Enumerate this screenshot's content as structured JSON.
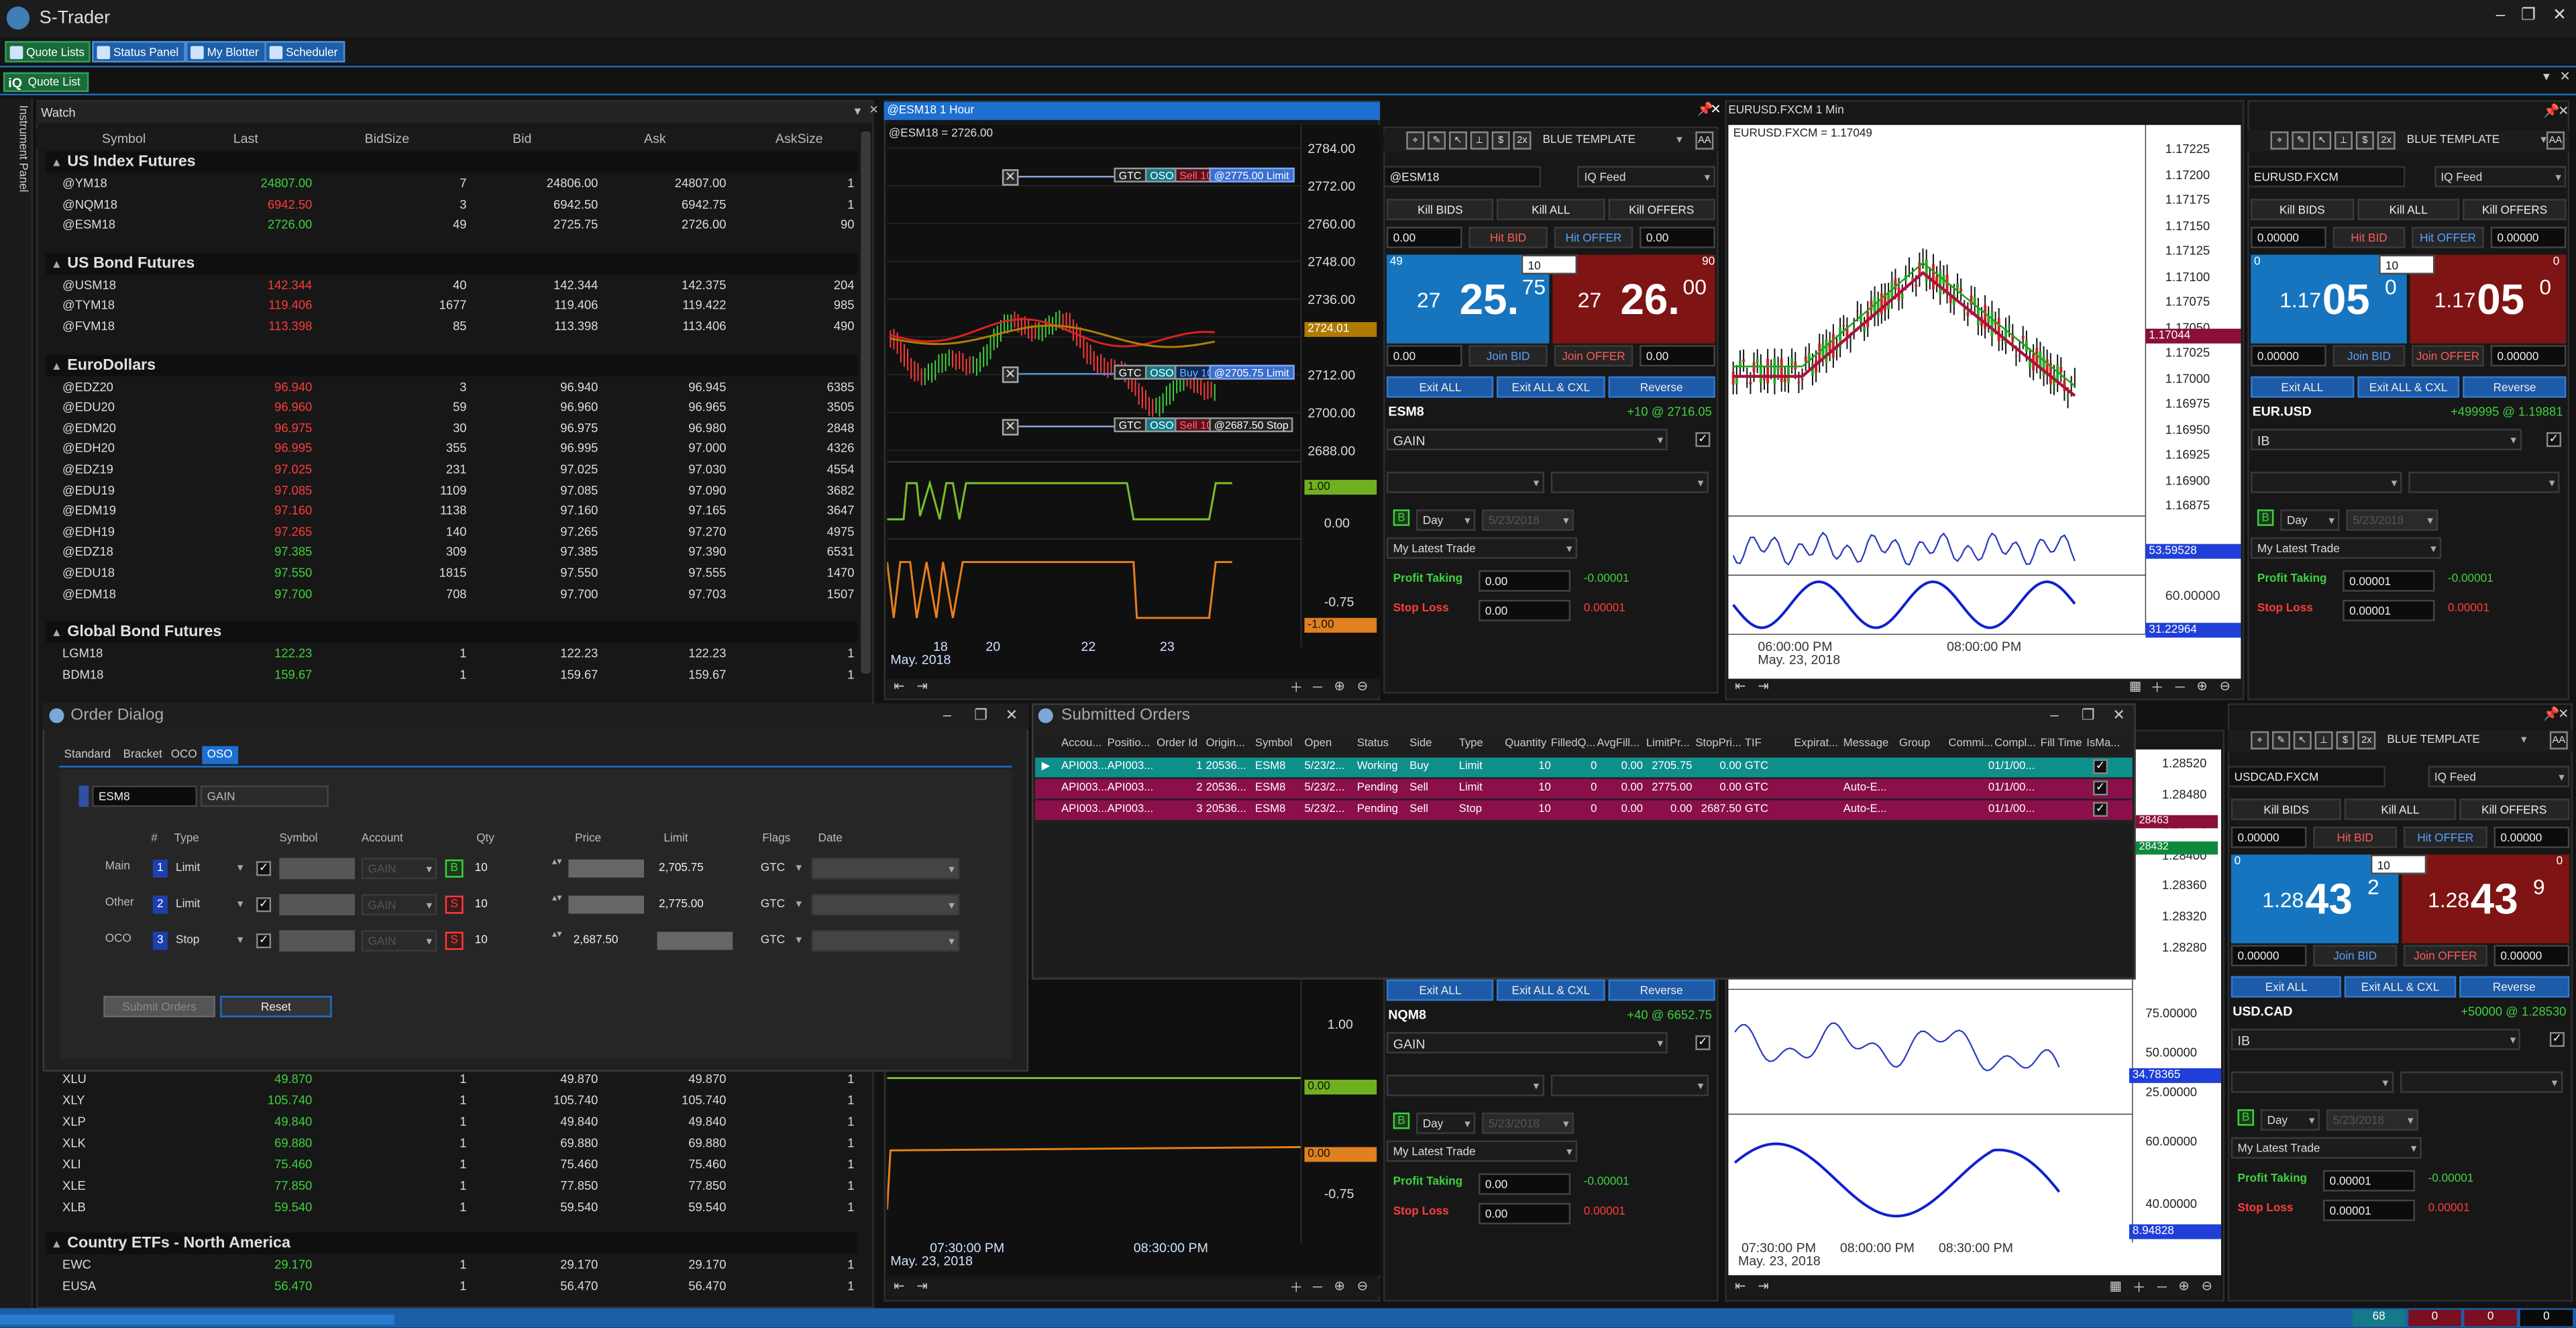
{
  "app": {
    "title": "S-Trader"
  },
  "toolbar": {
    "quote_lists": "Quote Lists",
    "status_panel": "Status Panel",
    "my_blotter": "My Blotter",
    "scheduler": "Scheduler"
  },
  "quote_list_tab": "Quote List",
  "instrument_panel": "Instrument Panel",
  "watch": {
    "title": "Watch",
    "columns": [
      "Symbol",
      "Last",
      "BidSize",
      "Bid",
      "Ask",
      "AskSize"
    ],
    "groups_top": [
      {
        "name": "US Index Futures",
        "rows": [
          {
            "symbol": "@YM18",
            "last": "24807.00",
            "dir": "up",
            "bidsize": "7",
            "bid": "24806.00",
            "ask": "24807.00",
            "asksize": "1"
          },
          {
            "symbol": "@NQM18",
            "last": "6942.50",
            "dir": "dn",
            "bidsize": "3",
            "bid": "6942.50",
            "ask": "6942.75",
            "asksize": "1"
          },
          {
            "symbol": "@ESM18",
            "last": "2726.00",
            "dir": "up",
            "bidsize": "49",
            "bid": "2725.75",
            "ask": "2726.00",
            "asksize": "90"
          }
        ]
      },
      {
        "name": "US Bond Futures",
        "rows": [
          {
            "symbol": "@USM18",
            "last": "142.344",
            "dir": "dn",
            "bidsize": "40",
            "bid": "142.344",
            "ask": "142.375",
            "asksize": "204"
          },
          {
            "symbol": "@TYM18",
            "last": "119.406",
            "dir": "dn",
            "bidsize": "1677",
            "bid": "119.406",
            "ask": "119.422",
            "asksize": "985"
          },
          {
            "symbol": "@FVM18",
            "last": "113.398",
            "dir": "dn",
            "bidsize": "85",
            "bid": "113.398",
            "ask": "113.406",
            "asksize": "490"
          }
        ]
      },
      {
        "name": "EuroDollars",
        "rows": [
          {
            "symbol": "@EDZ20",
            "last": "96.940",
            "dir": "dn",
            "bidsize": "3",
            "bid": "96.940",
            "ask": "96.945",
            "asksize": "6385"
          },
          {
            "symbol": "@EDU20",
            "last": "96.960",
            "dir": "dn",
            "bidsize": "59",
            "bid": "96.960",
            "ask": "96.965",
            "asksize": "3505"
          },
          {
            "symbol": "@EDM20",
            "last": "96.975",
            "dir": "dn",
            "bidsize": "30",
            "bid": "96.975",
            "ask": "96.980",
            "asksize": "2848"
          },
          {
            "symbol": "@EDH20",
            "last": "96.995",
            "dir": "dn",
            "bidsize": "355",
            "bid": "96.995",
            "ask": "97.000",
            "asksize": "4326"
          },
          {
            "symbol": "@EDZ19",
            "last": "97.025",
            "dir": "dn",
            "bidsize": "231",
            "bid": "97.025",
            "ask": "97.030",
            "asksize": "4554"
          },
          {
            "symbol": "@EDU19",
            "last": "97.085",
            "dir": "dn",
            "bidsize": "1109",
            "bid": "97.085",
            "ask": "97.090",
            "asksize": "3682"
          },
          {
            "symbol": "@EDM19",
            "last": "97.160",
            "dir": "dn",
            "bidsize": "1138",
            "bid": "97.160",
            "ask": "97.165",
            "asksize": "3647"
          },
          {
            "symbol": "@EDH19",
            "last": "97.265",
            "dir": "dn",
            "bidsize": "140",
            "bid": "97.265",
            "ask": "97.270",
            "asksize": "4975"
          },
          {
            "symbol": "@EDZ18",
            "last": "97.385",
            "dir": "up",
            "bidsize": "309",
            "bid": "97.385",
            "ask": "97.390",
            "asksize": "6531"
          },
          {
            "symbol": "@EDU18",
            "last": "97.550",
            "dir": "up",
            "bidsize": "1815",
            "bid": "97.550",
            "ask": "97.555",
            "asksize": "1470"
          },
          {
            "symbol": "@EDM18",
            "last": "97.700",
            "dir": "up",
            "bidsize": "708",
            "bid": "97.700",
            "ask": "97.703",
            "asksize": "1507"
          }
        ]
      },
      {
        "name": "Global Bond Futures",
        "rows": [
          {
            "symbol": "LGM18",
            "last": "122.23",
            "dir": "up",
            "bidsize": "1",
            "bid": "122.23",
            "ask": "122.23",
            "asksize": "1"
          },
          {
            "symbol": "BDM18",
            "last": "159.67",
            "dir": "up",
            "bidsize": "1",
            "bid": "159.67",
            "ask": "159.67",
            "asksize": "1"
          }
        ]
      }
    ],
    "etf_rows": [
      {
        "symbol": "XLU",
        "last": "49.870",
        "dir": "up",
        "bidsize": "1",
        "bid": "49.870",
        "ask": "49.870",
        "asksize": "1"
      },
      {
        "symbol": "XLY",
        "last": "105.740",
        "dir": "up",
        "bidsize": "1",
        "bid": "105.740",
        "ask": "105.740",
        "asksize": "1"
      },
      {
        "symbol": "XLP",
        "last": "49.840",
        "dir": "up",
        "bidsize": "1",
        "bid": "49.840",
        "ask": "49.840",
        "asksize": "1"
      },
      {
        "symbol": "XLK",
        "last": "69.880",
        "dir": "up",
        "bidsize": "1",
        "bid": "69.880",
        "ask": "69.880",
        "asksize": "1"
      },
      {
        "symbol": "XLI",
        "last": "75.460",
        "dir": "up",
        "bidsize": "1",
        "bid": "75.460",
        "ask": "75.460",
        "asksize": "1"
      },
      {
        "symbol": "XLE",
        "last": "77.850",
        "dir": "up",
        "bidsize": "1",
        "bid": "77.850",
        "ask": "77.850",
        "asksize": "1"
      },
      {
        "symbol": "XLB",
        "last": "59.540",
        "dir": "up",
        "bidsize": "1",
        "bid": "59.540",
        "ask": "59.540",
        "asksize": "1"
      }
    ],
    "group_country": {
      "name": "Country ETFs - North America",
      "rows": [
        {
          "symbol": "EWC",
          "last": "29.170",
          "dir": "up",
          "bidsize": "1",
          "bid": "29.170",
          "ask": "29.170",
          "asksize": "1"
        },
        {
          "symbol": "EUSA",
          "last": "56.470",
          "dir": "up",
          "bidsize": "1",
          "bid": "56.470",
          "ask": "56.470",
          "asksize": "1"
        }
      ]
    }
  },
  "chart1": {
    "title": "@ESM18 1 Hour",
    "legend": "@ESM18 = 2726.00",
    "y_labels": [
      "2784.00",
      "2772.00",
      "2760.00",
      "2748.00",
      "2736.00",
      "2724.01",
      "2712.00",
      "2700.00",
      "2688.00"
    ],
    "price_tag": "2724.01",
    "osc_labels": [
      "1.00",
      "0.00",
      "-0.75",
      "-1.00"
    ],
    "x_labels": [
      "18",
      "20",
      "22",
      "23"
    ],
    "x_sub": "May. 2018",
    "orders": [
      {
        "tif": "GTC",
        "oso": "OSO",
        "side": "Sell 10",
        "price": "@2775.00 Limit"
      },
      {
        "tif": "GTC",
        "oso": "OSO",
        "side": "Buy 10",
        "price": "@2705.75 Limit"
      },
      {
        "tif": "GTC",
        "oso": "OSO",
        "side": "Sell 10",
        "price": "@2687.50 Stop"
      }
    ],
    "lower_osc_labels": [
      "1.00",
      "0.00",
      "-0.75"
    ],
    "lower_x_labels": [
      "07:30:00 PM",
      "08:30:00 PM"
    ],
    "lower_x_sub": "May. 23, 2018"
  },
  "trade_es": {
    "template": "BLUE TEMPLATE",
    "symbol": "@ESM18",
    "feed": "IQ Feed",
    "kill_bids": "Kill BIDS",
    "kill_all": "Kill ALL",
    "kill_offers": "Kill OFFERS",
    "bid_in": "0.00",
    "ask_in": "0.00",
    "hit_bid": "Hit BID",
    "hit_offer": "Hit OFFER",
    "qty": "10",
    "bid_size": "49",
    "ask_size": "90",
    "bid_big": "25.",
    "bid_prefix": "27",
    "bid_sup": "75",
    "ask_big": "26.",
    "ask_prefix": "27",
    "ask_sup": "00",
    "join_bid": "Join BID",
    "join_offer": "Join OFFER",
    "exit_all": "Exit ALL",
    "exit_all_cxl": "Exit ALL & CXL",
    "reverse": "Reverse",
    "pos_symbol": "ESM8",
    "pos": "+10 @ 2716.05",
    "account": "GAIN",
    "tif": "Day",
    "date": "5/23/2018",
    "strategy": "My Latest Trade",
    "pt_label": "Profit Taking",
    "pt_val": "0.00",
    "pt_delta": "-0.00001",
    "sl_label": "Stop Loss",
    "sl_val": "0.00",
    "sl_delta": "0.00001",
    "b": "B"
  },
  "trade_nq": {
    "exit_all": "Exit ALL",
    "exit_all_cxl": "Exit ALL & CXL",
    "reverse": "Reverse",
    "pos_symbol": "NQM8",
    "pos": "+40 @ 6652.75",
    "account": "GAIN",
    "tif": "Day",
    "date": "5/23/2018",
    "strategy": "My Latest Trade",
    "pt_label": "Profit Taking",
    "pt_val": "0.00",
    "pt_delta": "-0.00001",
    "sl_label": "Stop Loss",
    "sl_val": "0.00",
    "sl_delta": "0.00001",
    "b": "B"
  },
  "chart2": {
    "title": "EURUSD.FXCM 1 Min",
    "legend": "EURUSD.FXCM = 1.17049",
    "y_labels": [
      "1.17225",
      "1.17200",
      "1.17175",
      "1.17150",
      "1.17125",
      "1.17100",
      "1.17075",
      "1.17050",
      "1.17025",
      "1.17000",
      "1.16975",
      "1.16950",
      "1.16925",
      "1.16900",
      "1.16875"
    ],
    "price_tag": "1.17044",
    "osc_tag": "53.59528",
    "osc2_label": "60.00000",
    "osc2_tag": "31.22964",
    "x_labels": [
      "06:00:00 PM",
      "08:00:00 PM"
    ],
    "x_sub": "May. 23, 2018"
  },
  "chart3": {
    "y_labels": [
      "1.28520",
      "1.28480",
      "1.28440",
      "1.28400",
      "1.28360",
      "1.28320",
      "1.28280"
    ],
    "tags": [
      "28463",
      "28432"
    ],
    "osc_labels": [
      "75.00000",
      "50.00000",
      "25.00000"
    ],
    "osc_tag": "34.78365",
    "osc2_labels": [
      "60.00000",
      "40.00000"
    ],
    "osc2_tag": "8.94828",
    "x_labels": [
      "07:30:00 PM",
      "08:00:00 PM",
      "08:30:00 PM"
    ],
    "x_sub": "May. 23, 2018"
  },
  "trade_eur": {
    "template": "BLUE TEMPLATE",
    "symbol": "EURUSD.FXCM",
    "feed": "IQ Feed",
    "kill_bids": "Kill BIDS",
    "kill_all": "Kill ALL",
    "kill_offers": "Kill OFFERS",
    "bid_in": "0.00000",
    "ask_in": "0.00000",
    "hit_bid": "Hit BID",
    "hit_offer": "Hit OFFER",
    "qty": "10",
    "bid_size": "0",
    "ask_size": "0",
    "bid_prefix": "1.17",
    "bid_big": "05",
    "bid_sup": "0",
    "ask_prefix": "1.17",
    "ask_big": "05",
    "ask_sup": "0",
    "join_bid": "Join BID",
    "join_offer": "Join OFFER",
    "exit_all": "Exit ALL",
    "exit_all_cxl": "Exit ALL & CXL",
    "reverse": "Reverse",
    "pos_symbol": "EUR.USD",
    "pos": "+499995 @ 1.19881",
    "account": "IB",
    "tif": "Day",
    "date": "5/23/2018",
    "strategy": "My Latest Trade",
    "pt_label": "Profit Taking",
    "pt_val": "0.00001",
    "pt_delta": "-0.00001",
    "sl_label": "Stop Loss",
    "sl_val": "0.00001",
    "sl_delta": "0.00001",
    "b": "B"
  },
  "trade_cad": {
    "template": "BLUE TEMPLATE",
    "symbol": "USDCAD.FXCM",
    "feed": "IQ Feed",
    "kill_bids": "Kill BIDS",
    "kill_all": "Kill ALL",
    "kill_offers": "Kill OFFERS",
    "bid_in": "0.00000",
    "ask_in": "0.00000",
    "hit_bid": "Hit BID",
    "hit_offer": "Hit OFFER",
    "qty": "10",
    "bid_size": "0",
    "ask_size": "0",
    "bid_prefix": "1.28",
    "bid_big": "43",
    "bid_sup": "2",
    "ask_prefix": "1.28",
    "ask_big": "43",
    "ask_sup": "9",
    "join_bid": "Join BID",
    "join_offer": "Join OFFER",
    "exit_all": "Exit ALL",
    "exit_all_cxl": "Exit ALL & CXL",
    "reverse": "Reverse",
    "pos_symbol": "USD.CAD",
    "pos": "+50000 @ 1.28530",
    "account": "IB",
    "tif": "Day",
    "date": "5/23/2018",
    "strategy": "My Latest Trade",
    "pt_label": "Profit Taking",
    "pt_val": "0.00001",
    "pt_delta": "-0.00001",
    "sl_label": "Stop Loss",
    "sl_val": "0.00001",
    "sl_delta": "0.00001",
    "b": "B"
  },
  "order_dialog": {
    "title": "Order Dialog",
    "tabs": [
      "Standard",
      "Bracket",
      "OCO",
      "OSO"
    ],
    "symbol": "ESM8",
    "account": "GAIN",
    "cols": [
      "#",
      "Type",
      "Symbol",
      "Account",
      "Qty",
      "Price",
      "Limit",
      "Flags",
      "Date"
    ],
    "rows": [
      {
        "label": "Main",
        "num": "1",
        "type": "Limit",
        "side": "B",
        "qty": "10",
        "limit": "2,705.75",
        "flags": "GTC",
        "account": "GAIN"
      },
      {
        "label": "Other",
        "num": "2",
        "type": "Limit",
        "side": "S",
        "qty": "10",
        "limit": "2,775.00",
        "flags": "GTC",
        "account": "GAIN"
      },
      {
        "label": "OCO",
        "num": "3",
        "type": "Stop",
        "side": "S",
        "qty": "10",
        "price": "2,687.50",
        "flags": "GTC",
        "account": "GAIN"
      }
    ],
    "submit": "Submit Orders",
    "reset": "Reset"
  },
  "submitted": {
    "title": "Submitted Orders",
    "cols": [
      "Accou...",
      "Positio...",
      "Order Id",
      "Origin...",
      "Symbol",
      "Open",
      "Status",
      "Side",
      "Type",
      "Quantity",
      "FilledQ...",
      "AvgFill...",
      "LimitPr...",
      "StopPri...",
      "TIF",
      "Expirat...",
      "Message",
      "Group",
      "Commi...",
      "Compl...",
      "Fill Time",
      "IsMa..."
    ],
    "rows": [
      {
        "acct": "API003...",
        "pos": "API003...",
        "id": "1",
        "orig": "20536...",
        "sym": "ESM8",
        "open": "5/23/2...",
        "status": "Working",
        "side": "Buy",
        "type": "Limit",
        "qty": "10",
        "filled": "0",
        "avg": "0.00",
        "limit": "2705.75",
        "stop": "0.00",
        "tif": "GTC",
        "exp": "",
        "msg": "",
        "grp": "",
        "comm": "0",
        "compl": "1/1/00...",
        "check": "✓"
      },
      {
        "acct": "API003...",
        "pos": "API003...",
        "id": "2",
        "orig": "20536...",
        "sym": "ESM8",
        "open": "5/23/2...",
        "status": "Pending",
        "side": "Sell",
        "type": "Limit",
        "qty": "10",
        "filled": "0",
        "avg": "0.00",
        "limit": "2775.00",
        "stop": "0.00",
        "tif": "GTC",
        "exp": "",
        "msg": "Auto-E...",
        "grp": "",
        "comm": "0",
        "compl": "1/1/00...",
        "check": "✓"
      },
      {
        "acct": "API003...",
        "pos": "API003...",
        "id": "3",
        "orig": "20536...",
        "sym": "ESM8",
        "open": "5/23/2...",
        "status": "Pending",
        "side": "Sell",
        "type": "Stop",
        "qty": "10",
        "filled": "0",
        "avg": "0.00",
        "limit": "0.00",
        "stop": "2687.50",
        "tif": "GTC",
        "exp": "",
        "msg": "Auto-E...",
        "grp": "",
        "comm": "0",
        "compl": "1/1/00...",
        "check": "✓"
      }
    ]
  },
  "status": {
    "count": "68",
    "a": "0",
    "b": "0",
    "c": "0"
  }
}
